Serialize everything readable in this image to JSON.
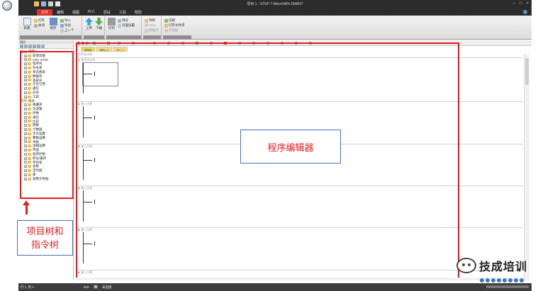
{
  "window": {
    "title": "项目 1 - STEP 7-Micro/WIN SMART"
  },
  "menu": {
    "tabs": [
      "文件",
      "编辑",
      "视图",
      "PLC",
      "调试",
      "工具",
      "帮助"
    ],
    "active_index": 0
  },
  "ribbon": {
    "new_label": "新建",
    "open_label": "打开",
    "close_label": "关闭",
    "save_label": "保存",
    "import_label": "导入",
    "export_label": "导出",
    "previous_label": "上一个",
    "upload_label": "上传",
    "download_label": "下载",
    "print_label": "打印",
    "preview_label": "预览",
    "page_setup_label": "页面设置",
    "project_label": "项目",
    "pos_label": "POS",
    "data_page_label": "数据页",
    "create_label": "创建",
    "open_file_label": "打开文件夹",
    "lib_storage_label": "存储器"
  },
  "left_pane": {
    "header": "项目",
    "tree": [
      {
        "label": "项目1",
        "level": 0,
        "expanded": true
      },
      {
        "label": "新增功能",
        "level": 1
      },
      {
        "label": "CPU ST30",
        "level": 1
      },
      {
        "label": "程序块",
        "level": 1
      },
      {
        "label": "符号表",
        "level": 1
      },
      {
        "label": "状态图表",
        "level": 1
      },
      {
        "label": "数据块",
        "level": 1
      },
      {
        "label": "系统块",
        "level": 1
      },
      {
        "label": "交叉引用",
        "level": 1
      },
      {
        "label": "通信",
        "level": 1
      },
      {
        "label": "向导",
        "level": 1
      },
      {
        "label": "工具",
        "level": 1
      },
      {
        "label": "指令",
        "level": 0,
        "expanded": true
      },
      {
        "label": "收藏夹",
        "level": 1
      },
      {
        "label": "位逻辑",
        "level": 1
      },
      {
        "label": "时钟",
        "level": 1
      },
      {
        "label": "通信",
        "level": 1
      },
      {
        "label": "比较",
        "level": 1
      },
      {
        "label": "转换",
        "level": 1
      },
      {
        "label": "计数器",
        "level": 1
      },
      {
        "label": "浮点运算",
        "level": 1
      },
      {
        "label": "整数运算",
        "level": 1
      },
      {
        "label": "中断",
        "level": 1
      },
      {
        "label": "逻辑运算",
        "level": 1
      },
      {
        "label": "传送",
        "level": 1
      },
      {
        "label": "程序控制",
        "level": 1
      },
      {
        "label": "移位/循环",
        "level": 1
      },
      {
        "label": "字符串",
        "level": 1
      },
      {
        "label": "表格",
        "level": 1
      },
      {
        "label": "定时器",
        "level": 1
      },
      {
        "label": "库",
        "level": 1
      },
      {
        "label": "调用子例程",
        "level": 1
      }
    ],
    "callout": "项目树和指令树"
  },
  "editor": {
    "tabs": [
      "MAIN",
      "SBR_0",
      "INT_0"
    ],
    "active_tab": 0,
    "program_comment": "程序段注释",
    "rungs": [
      {
        "num": "1",
        "comment": "程序段注释"
      },
      {
        "num": "2",
        "comment": "输入注释"
      },
      {
        "num": "3",
        "comment": "输入注释"
      },
      {
        "num": "4",
        "comment": "输入注释"
      },
      {
        "num": "5",
        "comment": "输入注释"
      },
      {
        "num": "6",
        "comment": "输入注释"
      }
    ],
    "callout": "程序编辑器"
  },
  "status": {
    "position": "行 1, 列 1",
    "mode": "INS",
    "connection": "未连接"
  },
  "watermark": {
    "text": "技成培训"
  },
  "colors": {
    "accent_red": "#e02020",
    "tab_active": "#d8342a",
    "callout_border": "#4a6fc0",
    "folder_yellow": "#e8c25a"
  }
}
